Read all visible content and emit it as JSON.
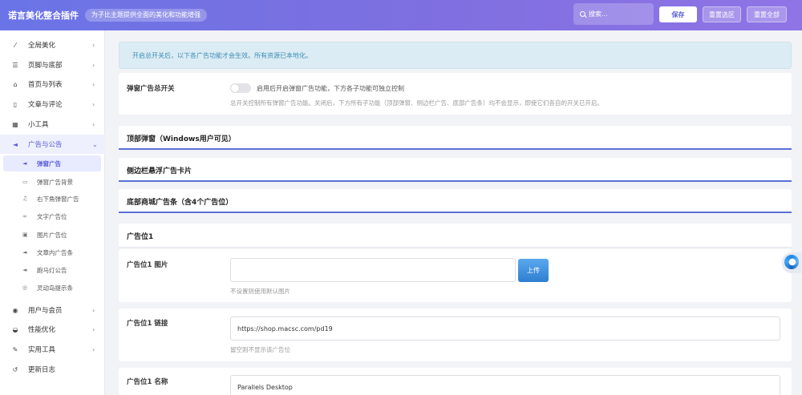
{
  "header": {
    "brand": "诺言美化整合插件",
    "tagline": "为子比主题提供全面的美化和功能增强",
    "search_placeholder": "搜索...",
    "save_label": "保存",
    "reset_section_label": "重置选区",
    "reset_all_label": "重置全部"
  },
  "sidebar": {
    "items": [
      {
        "label": "全局美化",
        "icon": "wand-icon"
      },
      {
        "label": "页脚与底部",
        "icon": "bars-icon"
      },
      {
        "label": "首页与列表",
        "icon": "home-icon"
      },
      {
        "label": "文章与评论",
        "icon": "document-icon"
      },
      {
        "label": "小工具",
        "icon": "grid-icon"
      },
      {
        "label": "广告与公告",
        "icon": "megaphone-icon"
      }
    ],
    "sub_items": [
      {
        "label": "弹窗广告",
        "icon": "megaphone-icon"
      },
      {
        "label": "弹窗广告背景",
        "icon": "window-icon"
      },
      {
        "label": "右下角弹窗广告",
        "icon": "bell-icon"
      },
      {
        "label": "文字广告位",
        "icon": "link-icon"
      },
      {
        "label": "图片广告位",
        "icon": "image-icon"
      },
      {
        "label": "文章内广告条",
        "icon": "megaphone-icon"
      },
      {
        "label": "跑马灯公告",
        "icon": "megaphone-icon"
      },
      {
        "label": "灵动岛提示条",
        "icon": "circle-icon"
      }
    ],
    "bottom_items": [
      {
        "label": "用户与会员",
        "icon": "user-icon"
      },
      {
        "label": "性能优化",
        "icon": "gauge-icon"
      },
      {
        "label": "实用工具",
        "icon": "wrench-icon"
      },
      {
        "label": "更新日志",
        "icon": "history-icon"
      }
    ]
  },
  "main": {
    "notice": "开启总开关后，以下各广告功能才会生效。所有资源已本地化。",
    "master_switch": {
      "label": "弹窗广告总开关",
      "toggle_text": "启用后开启弹窗广告功能，下方各子功能可独立控制",
      "description": "总开关控制所有弹窗广告功能。关闭后，下方所有子功能（顶部弹窗、侧边栏广告、底部广告条）均不会显示，即使它们各自的开关已开启。"
    },
    "sections": {
      "top_popup": "顶部弹窗（Windows用户可见）",
      "sidebar_card": "侧边栏悬浮广告卡片",
      "bottom_bar": "底部商城广告条（含4个广告位）",
      "slot1": "广告位1"
    },
    "slot1_image": {
      "label": "广告位1 图片",
      "value": "",
      "upload_label": "上传",
      "hint": "不设置则使用默认图片"
    },
    "slot1_link": {
      "label": "广告位1 链接",
      "value": "https://shop.macsc.com/pd19",
      "hint": "留空则不显示该广告位"
    },
    "slot1_name": {
      "label": "广告位1 名称",
      "value": "Parallels Desktop"
    }
  },
  "colors": {
    "header_start": "#6a74e6",
    "header_end": "#8f74e6",
    "accent": "#5b5fd6",
    "notice_bg": "#dcecf4",
    "upload_button": "#2f7fd0"
  }
}
